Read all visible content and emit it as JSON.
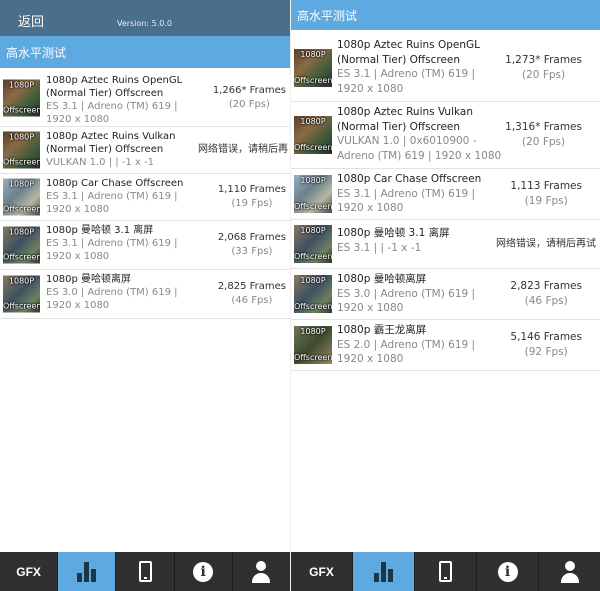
{
  "left": {
    "appbar": {
      "back_label": "返回",
      "version": "Version: 5.0.0"
    },
    "section_title": "高水平测试",
    "rows": [
      {
        "thumb_res": "1080P",
        "thumb_mode": "Offscreen",
        "title": "1080p Aztec Ruins OpenGL (Normal Tier) Offscreen",
        "meta1": "ES 3.1 | Adreno (TM) 619 |",
        "meta2": "1920 x 1080",
        "frames": "1,266* Frames",
        "fps": "(20 Fps)"
      },
      {
        "thumb_res": "1080P",
        "thumb_mode": "Offscreen",
        "title": "1080p Aztec Ruins Vulkan (Normal Tier) Offscreen",
        "meta1": "VULKAN 1.0 | | -1 x -1",
        "meta2": "",
        "error": "网络错误，请稍后再"
      },
      {
        "thumb_res": "1080P",
        "thumb_mode": "Offscreen",
        "title": "1080p Car Chase Offscreen",
        "meta1": "ES 3.1 | Adreno (TM) 619 |",
        "meta2": "1920 x 1080",
        "frames": "1,110 Frames",
        "fps": "(19 Fps)"
      },
      {
        "thumb_res": "1080P",
        "thumb_mode": "Offscreen",
        "title": "1080p 曼哈顿 3.1 离屏",
        "meta1": "ES 3.1 | Adreno (TM) 619 |",
        "meta2": "1920 x 1080",
        "frames": "2,068 Frames",
        "fps": "(33 Fps)"
      },
      {
        "thumb_res": "1080P",
        "thumb_mode": "Offscreen",
        "title": "1080p 曼哈顿离屏",
        "meta1": "ES 3.0 | Adreno (TM) 619 |",
        "meta2": "1920 x 1080",
        "frames": "2,825 Frames",
        "fps": "(46 Fps)"
      }
    ]
  },
  "right": {
    "section_title": "高水平测试",
    "rows": [
      {
        "thumb_res": "1080P",
        "thumb_mode": "Offscreen",
        "title1": "1080p Aztec Ruins OpenGL",
        "title2": "(Normal Tier) Offscreen",
        "meta1": "ES 3.1 | Adreno (TM) 619 |",
        "meta2": "1920 x 1080",
        "frames": "1,273* Frames",
        "fps": "(20 Fps)"
      },
      {
        "thumb_res": "1080P",
        "thumb_mode": "Offscreen",
        "title1": "1080p Aztec Ruins Vulkan",
        "title2": "(Normal Tier) Offscreen",
        "meta1": "VULKAN 1.0 | 0x6010900 -",
        "meta2": "Adreno (TM) 619 | 1920 x 1080",
        "frames": "1,316* Frames",
        "fps": "(20 Fps)"
      },
      {
        "thumb_res": "1080P",
        "thumb_mode": "Offscreen",
        "title1": "1080p Car Chase Offscreen",
        "title2": "",
        "meta1": "ES 3.1 | Adreno (TM) 619 |",
        "meta2": "1920 x 1080",
        "frames": "1,113 Frames",
        "fps": "(19 Fps)"
      },
      {
        "thumb_res": "1080P",
        "thumb_mode": "Offscreen",
        "title1": "1080p 曼哈顿 3.1 离屏",
        "title2": "",
        "meta1": "ES 3.1 | | -1 x -1",
        "meta2": "",
        "error": "网络错误，请稍后再试"
      },
      {
        "thumb_res": "1080P",
        "thumb_mode": "Offscreen",
        "title1": "1080p 曼哈顿离屏",
        "title2": "",
        "meta1": "ES 3.0 | Adreno (TM) 619 |",
        "meta2": "1920 x 1080",
        "frames": "2,823 Frames",
        "fps": "(46 Fps)"
      },
      {
        "thumb_res": "1080P",
        "thumb_mode": "Offscreen",
        "title1": "1080p 霸王龙离屏",
        "title2": "",
        "meta1": "ES 2.0 | Adreno (TM) 619 |",
        "meta2": "1920 x 1080",
        "frames": "5,146 Frames",
        "fps": "(92 Fps)"
      }
    ]
  },
  "tabbar": {
    "gfx_label": "GFX",
    "icons": [
      "bar-chart-icon",
      "phone-icon",
      "info-icon",
      "user-icon"
    ],
    "active_color": "#5ea9e0",
    "inactive_color": "#303030"
  },
  "colors": {
    "appbar": "#4a6f8c",
    "section_header": "#5ea9e0",
    "bar_chart_icon": "#1e3448"
  }
}
